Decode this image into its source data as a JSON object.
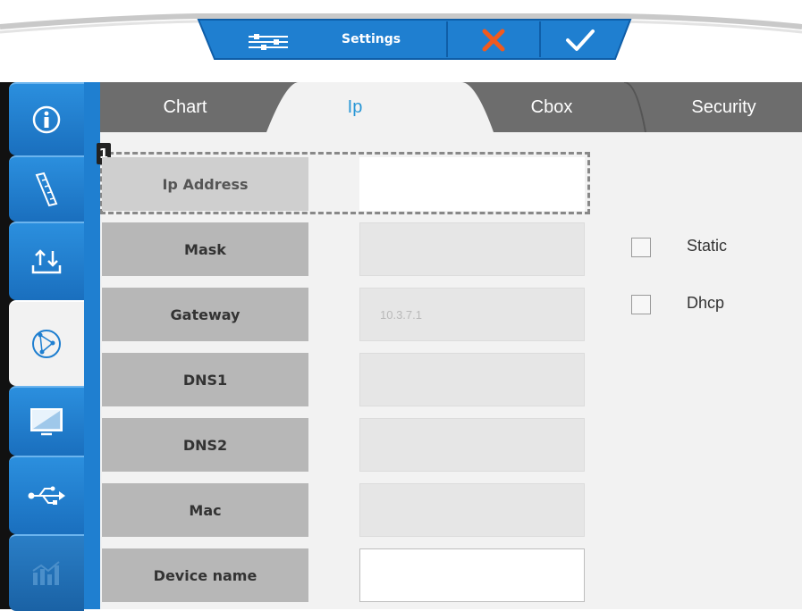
{
  "toolbar": {
    "settings_label": "Settings",
    "settings_icon": "sliders-icon",
    "cancel_icon": "close-icon",
    "confirm_icon": "check-icon",
    "colors": {
      "accent": "#1f7fd0",
      "cancel": "#f05a1e",
      "bar": "#ffffff"
    }
  },
  "sidebar": {
    "items": [
      {
        "name": "info",
        "icon": "info-icon"
      },
      {
        "name": "calibration",
        "icon": "ruler-icon"
      },
      {
        "name": "import-export",
        "icon": "upload-download-icon"
      },
      {
        "name": "network",
        "icon": "network-icon",
        "active": true
      },
      {
        "name": "display",
        "icon": "monitor-icon"
      },
      {
        "name": "usb",
        "icon": "usb-icon"
      },
      {
        "name": "statistics",
        "icon": "chart-icon",
        "disabled": true
      }
    ]
  },
  "tabs": [
    {
      "label": "Chart"
    },
    {
      "label": "Ip",
      "active": true
    },
    {
      "label": "Cbox"
    },
    {
      "label": "Security"
    }
  ],
  "badge": "1",
  "fields": [
    {
      "label": "Ip Address",
      "value": ""
    },
    {
      "label": "Mask",
      "value": ""
    },
    {
      "label": "Gateway",
      "value": "10.3.7.1"
    },
    {
      "label": "DNS1",
      "value": ""
    },
    {
      "label": "DNS2",
      "value": ""
    },
    {
      "label": "Mac",
      "value": ""
    },
    {
      "label": "Device name",
      "value": ""
    }
  ],
  "mode_options": [
    {
      "label": "Static",
      "checked": false
    },
    {
      "label": "Dhcp",
      "checked": false
    }
  ]
}
